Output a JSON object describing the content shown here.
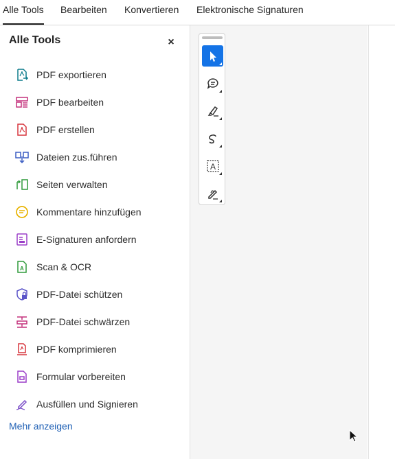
{
  "tabs": [
    {
      "label": "Alle Tools",
      "active": true
    },
    {
      "label": "Bearbeiten",
      "active": false
    },
    {
      "label": "Konvertieren",
      "active": false
    },
    {
      "label": "Elektronische Signaturen",
      "active": false
    }
  ],
  "panel": {
    "title": "Alle Tools",
    "close_symbol": "×",
    "items": [
      {
        "label": "PDF exportieren",
        "icon": "pdf-export-icon",
        "color": "#0d7c8c"
      },
      {
        "label": "PDF bearbeiten",
        "icon": "pdf-edit-icon",
        "color": "#c4307c"
      },
      {
        "label": "PDF erstellen",
        "icon": "pdf-create-icon",
        "color": "#d7373f"
      },
      {
        "label": "Dateien zus.führen",
        "icon": "merge-files-icon",
        "color": "#3d5fc4"
      },
      {
        "label": "Seiten verwalten",
        "icon": "organize-pages-icon",
        "color": "#2f9a3a"
      },
      {
        "label": "Kommentare hinzufügen",
        "icon": "comment-icon",
        "color": "#e8b300"
      },
      {
        "label": "E-Signaturen anfordern",
        "icon": "request-esign-icon",
        "color": "#9b3fc8"
      },
      {
        "label": "Scan & OCR",
        "icon": "scan-ocr-icon",
        "color": "#2f9a3a"
      },
      {
        "label": "PDF-Datei schützen",
        "icon": "protect-icon",
        "color": "#5b55c9"
      },
      {
        "label": "PDF-Datei schwärzen",
        "icon": "redact-icon",
        "color": "#c4307c"
      },
      {
        "label": "PDF komprimieren",
        "icon": "compress-icon",
        "color": "#d7373f"
      },
      {
        "label": "Formular vorbereiten",
        "icon": "form-icon",
        "color": "#9b3fc8"
      },
      {
        "label": "Ausfüllen und Signieren",
        "icon": "fill-sign-icon",
        "color": "#7c4fc8"
      }
    ],
    "more_link": "Mehr anzeigen"
  },
  "quick_toolbar": [
    {
      "name": "select-tool",
      "icon": "cursor-arrow-icon",
      "selected": true
    },
    {
      "name": "comment-tool",
      "icon": "comment-bubble-icon",
      "selected": false
    },
    {
      "name": "highlight-tool",
      "icon": "highlighter-icon",
      "selected": false
    },
    {
      "name": "draw-tool",
      "icon": "freehand-draw-icon",
      "selected": false
    },
    {
      "name": "text-select-tool",
      "icon": "text-box-icon",
      "selected": false
    },
    {
      "name": "sign-tool",
      "icon": "pen-sign-icon",
      "selected": false
    }
  ],
  "colors": {
    "accent": "#1473e6",
    "link": "#1e5fb4"
  }
}
